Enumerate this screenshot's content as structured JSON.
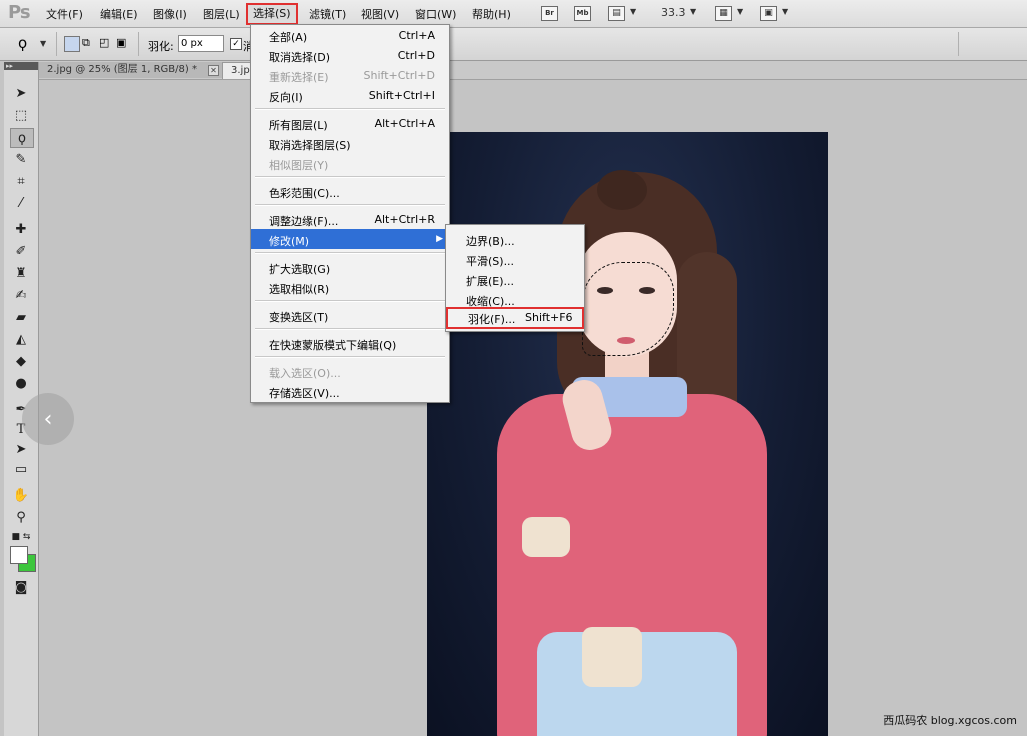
{
  "app": {
    "logo": "Ps"
  },
  "menubar": {
    "items": [
      "文件(F)",
      "编辑(E)",
      "图像(I)",
      "图层(L)",
      "选择(S)",
      "滤镜(T)",
      "视图(V)",
      "窗口(W)",
      "帮助(H)"
    ],
    "active_index": 4,
    "buttons": [
      "Br",
      "Mb"
    ],
    "zoom": "33.3"
  },
  "options": {
    "feather_label": "羽化:",
    "feather_value": "0 px",
    "antialias_label": "消"
  },
  "tabs": [
    {
      "label": "2.jpg @ 25% (图层 1, RGB/8) *"
    },
    {
      "label": "3.jp"
    }
  ],
  "select_menu": {
    "groups": [
      [
        {
          "label": "全部(A)",
          "shortcut": "Ctrl+A",
          "disabled": false
        },
        {
          "label": "取消选择(D)",
          "shortcut": "Ctrl+D",
          "disabled": false
        },
        {
          "label": "重新选择(E)",
          "shortcut": "Shift+Ctrl+D",
          "disabled": true
        },
        {
          "label": "反向(I)",
          "shortcut": "Shift+Ctrl+I",
          "disabled": false
        }
      ],
      [
        {
          "label": "所有图层(L)",
          "shortcut": "Alt+Ctrl+A",
          "disabled": false
        },
        {
          "label": "取消选择图层(S)",
          "shortcut": "",
          "disabled": false
        },
        {
          "label": "相似图层(Y)",
          "shortcut": "",
          "disabled": true
        }
      ],
      [
        {
          "label": "色彩范围(C)...",
          "shortcut": "",
          "disabled": false
        }
      ],
      [
        {
          "label": "调整边缘(F)...",
          "shortcut": "Alt+Ctrl+R",
          "disabled": false
        },
        {
          "label": "修改(M)",
          "shortcut": "",
          "disabled": false,
          "highlighted": true,
          "submenu": true
        }
      ],
      [
        {
          "label": "扩大选取(G)",
          "shortcut": "",
          "disabled": false
        },
        {
          "label": "选取相似(R)",
          "shortcut": "",
          "disabled": false
        }
      ],
      [
        {
          "label": "变换选区(T)",
          "shortcut": "",
          "disabled": false
        }
      ],
      [
        {
          "label": "在快速蒙版模式下编辑(Q)",
          "shortcut": "",
          "disabled": false
        }
      ],
      [
        {
          "label": "载入选区(O)...",
          "shortcut": "",
          "disabled": true
        },
        {
          "label": "存储选区(V)...",
          "shortcut": "",
          "disabled": false
        }
      ]
    ]
  },
  "modify_submenu": {
    "items": [
      {
        "label": "边界(B)...",
        "shortcut": ""
      },
      {
        "label": "平滑(S)...",
        "shortcut": ""
      },
      {
        "label": "扩展(E)...",
        "shortcut": ""
      },
      {
        "label": "收缩(C)...",
        "shortcut": ""
      },
      {
        "label": "羽化(F)...",
        "shortcut": "Shift+F6",
        "boxed": true
      }
    ]
  },
  "colors": {
    "foreground": "#ffffff",
    "background": "#3cc63c",
    "highlight": "#2f6fd6",
    "callout": "#e03030"
  },
  "watermark": "西瓜码农 blog.xgcos.com"
}
